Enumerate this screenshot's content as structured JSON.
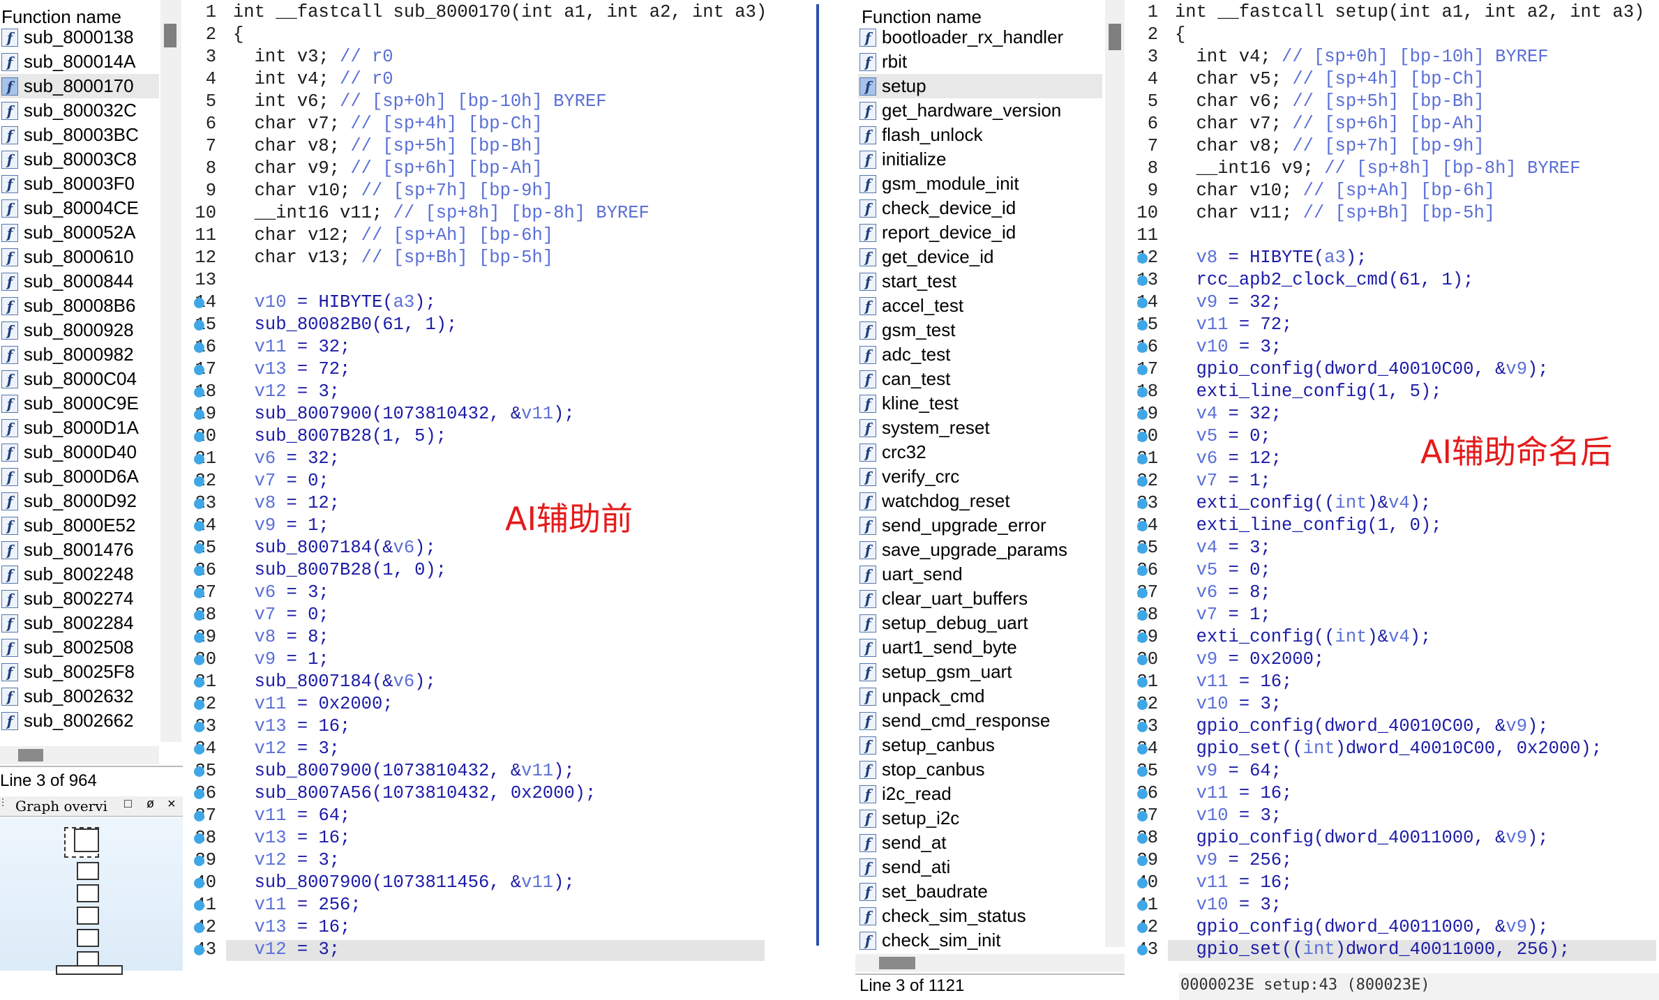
{
  "left": {
    "function_list": {
      "header": "Function name",
      "items": [
        "sub_8000138",
        "sub_800014A",
        "sub_8000170",
        "sub_800032C",
        "sub_80003BC",
        "sub_80003C8",
        "sub_80003F0",
        "sub_80004CE",
        "sub_800052A",
        "sub_8000610",
        "sub_8000844",
        "sub_80008B6",
        "sub_8000928",
        "sub_8000982",
        "sub_8000C04",
        "sub_8000C9E",
        "sub_8000D1A",
        "sub_8000D40",
        "sub_8000D6A",
        "sub_8000D92",
        "sub_8000E52",
        "sub_8001476",
        "sub_8002248",
        "sub_8002274",
        "sub_8002284",
        "sub_8002508",
        "sub_80025F8",
        "sub_8002632",
        "sub_8002662"
      ],
      "selected_index": 2,
      "status": "Line 3 of 964"
    },
    "graph_overview": {
      "title": "Graph overvi",
      "buttons": [
        "□",
        "ø",
        "×"
      ]
    },
    "code": {
      "lines": [
        "int __fastcall sub_8000170(int a1, int a2, int a3)",
        "{",
        "  int v3; // r0",
        "  int v4; // r0",
        "  int v6; // [sp+0h] [bp-10h] BYREF",
        "  char v7; // [sp+4h] [bp-Ch]",
        "  char v8; // [sp+5h] [bp-Bh]",
        "  char v9; // [sp+6h] [bp-Ah]",
        "  char v10; // [sp+7h] [bp-9h]",
        "  __int16 v11; // [sp+8h] [bp-8h] BYREF",
        "  char v12; // [sp+Ah] [bp-6h]",
        "  char v13; // [sp+Bh] [bp-5h]",
        "",
        "  v10 = HIBYTE(a3);",
        "  sub_80082B0(61, 1);",
        "  v11 = 32;",
        "  v13 = 72;",
        "  v12 = 3;",
        "  sub_8007900(1073810432, &v11);",
        "  sub_8007B28(1, 5);",
        "  v6 = 32;",
        "  v7 = 0;",
        "  v8 = 12;",
        "  v9 = 1;",
        "  sub_8007184(&v6);",
        "  sub_8007B28(1, 0);",
        "  v6 = 3;",
        "  v7 = 0;",
        "  v8 = 8;",
        "  v9 = 1;",
        "  sub_8007184(&v6);",
        "  v11 = 0x2000;",
        "  v13 = 16;",
        "  v12 = 3;",
        "  sub_8007900(1073810432, &v11);",
        "  sub_8007A56(1073810432, 0x2000);",
        "  v11 = 64;",
        "  v13 = 16;",
        "  v12 = 3;",
        "  sub_8007900(1073811456, &v11);",
        "  v11 = 256;",
        "  v13 = 16;",
        "  v12 = 3;"
      ]
    },
    "annotation": "AI辅助前"
  },
  "right": {
    "function_list": {
      "header": "Function name",
      "items": [
        "bootloader_rx_handler",
        "rbit",
        "setup",
        "get_hardware_version",
        "flash_unlock",
        "initialize",
        "gsm_module_init",
        "check_device_id",
        "report_device_id",
        "get_device_id",
        "start_test",
        "accel_test",
        "gsm_test",
        "adc_test",
        "can_test",
        "kline_test",
        "system_reset",
        "crc32",
        "verify_crc",
        "watchdog_reset",
        "send_upgrade_error",
        "save_upgrade_params",
        "uart_send",
        "clear_uart_buffers",
        "setup_debug_uart",
        "uart1_send_byte",
        "setup_gsm_uart",
        "unpack_cmd",
        "send_cmd_response",
        "setup_canbus",
        "stop_canbus",
        "i2c_read",
        "setup_i2c",
        "send_at",
        "send_ati",
        "set_baudrate",
        "check_sim_status",
        "check_sim_init"
      ],
      "selected_index": 2,
      "status": "Line 3 of 1121"
    },
    "code": {
      "lines": [
        "int __fastcall setup(int a1, int a2, int a3)",
        "{",
        "  int v4; // [sp+0h] [bp-10h] BYREF",
        "  char v5; // [sp+4h] [bp-Ch]",
        "  char v6; // [sp+5h] [bp-Bh]",
        "  char v7; // [sp+6h] [bp-Ah]",
        "  char v8; // [sp+7h] [bp-9h]",
        "  __int16 v9; // [sp+8h] [bp-8h] BYREF",
        "  char v10; // [sp+Ah] [bp-6h]",
        "  char v11; // [sp+Bh] [bp-5h]",
        "",
        "  v8 = HIBYTE(a3);",
        "  rcc_apb2_clock_cmd(61, 1);",
        "  v9 = 32;",
        "  v11 = 72;",
        "  v10 = 3;",
        "  gpio_config(dword_40010C00, &v9);",
        "  exti_line_config(1, 5);",
        "  v4 = 32;",
        "  v5 = 0;",
        "  v6 = 12;",
        "  v7 = 1;",
        "  exti_config((int)&v4);",
        "  exti_line_config(1, 0);",
        "  v4 = 3;",
        "  v5 = 0;",
        "  v6 = 8;",
        "  v7 = 1;",
        "  exti_config((int)&v4);",
        "  v9 = 0x2000;",
        "  v11 = 16;",
        "  v10 = 3;",
        "  gpio_config(dword_40010C00, &v9);",
        "  gpio_set((int)dword_40010C00, 0x2000);",
        "  v9 = 64;",
        "  v11 = 16;",
        "  v10 = 3;",
        "  gpio_config(dword_40011000, &v9);",
        "  v9 = 256;",
        "  v11 = 16;",
        "  v10 = 3;",
        "  gpio_config(dword_40011000, &v9);",
        "  gpio_set((int)dword_40011000, 256);"
      ],
      "status": "0000023E setup:43 (800023E)"
    },
    "annotation": "AI辅助命名后"
  }
}
